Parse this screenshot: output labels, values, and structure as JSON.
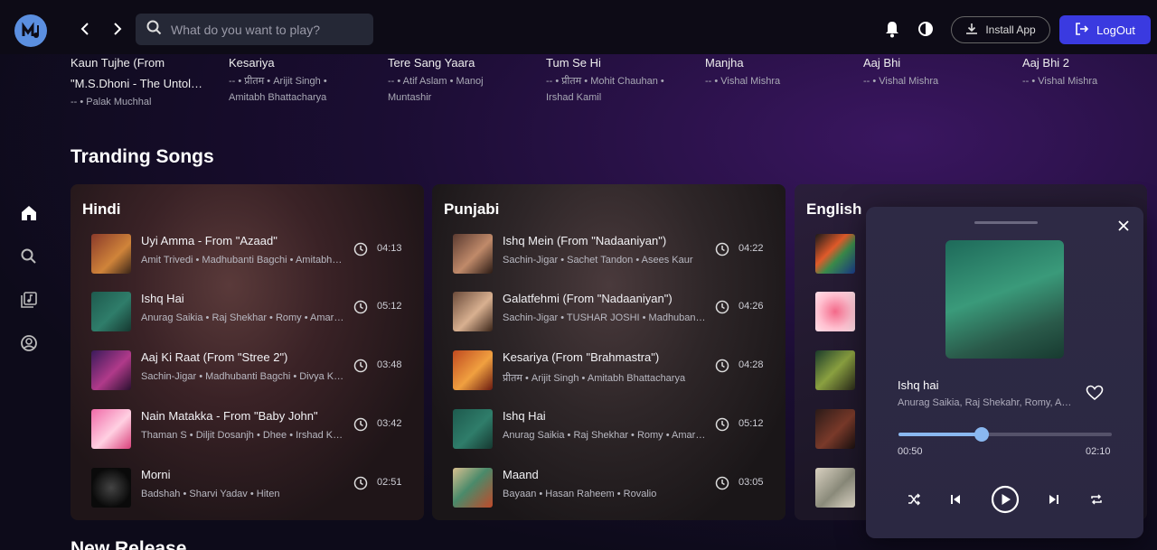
{
  "header": {
    "search_placeholder": "What do you want to play?",
    "install_label": "Install App",
    "logout_label": "LogOut"
  },
  "recent": [
    {
      "title1": "Kaun Tujhe (From",
      "title2": "\"M.S.Dhoni - The Untol…",
      "sub": "-- • Palak Muchhal"
    },
    {
      "title1": "Kesariya",
      "sub1": "-- • प्रीतम • Arijit Singh •",
      "sub2": "Amitabh Bhattacharya"
    },
    {
      "title1": "Tere Sang Yaara",
      "sub1": "-- • Atif Aslam • Manoj",
      "sub2": "Muntashir"
    },
    {
      "title1": "Tum Se Hi",
      "sub1": "-- • प्रीतम • Mohit Chauhan •",
      "sub2": "Irshad Kamil"
    },
    {
      "title1": "Manjha",
      "sub1": "-- • Vishal Mishra"
    },
    {
      "title1": "Aaj Bhi",
      "sub1": "-- • Vishal Mishra"
    },
    {
      "title1": "Aaj Bhi 2",
      "sub1": "-- • Vishal Mishra"
    }
  ],
  "trending_title": "Tranding Songs",
  "new_release_title": "New Release",
  "cards": [
    {
      "title": "Hindi",
      "songs": [
        {
          "name": "Uyi Amma - From \"Azaad\"",
          "artist": "Amit Trivedi • Madhubanti Bagchi • Amitabh Bhattacharya",
          "duration": "04:13"
        },
        {
          "name": "Ishq Hai",
          "artist": "Anurag Saikia • Raj Shekhar • Romy • Amarabha Banerjee",
          "duration": "05:12"
        },
        {
          "name": "Aaj Ki Raat (From \"Stree 2\")",
          "artist": "Sachin-Jigar • Madhubanti Bagchi • Divya Kumar",
          "duration": "03:48"
        },
        {
          "name": "Nain Matakka - From \"Baby John\"",
          "artist": "Thaman S • Diljit Dosanjh • Dhee • Irshad Kamil",
          "duration": "03:42"
        },
        {
          "name": "Morni",
          "artist": "Badshah • Sharvi Yadav • Hiten",
          "duration": "02:51"
        }
      ]
    },
    {
      "title": "Punjabi",
      "songs": [
        {
          "name": "Ishq Mein (From \"Nadaaniyan\")",
          "artist": "Sachin-Jigar • Sachet Tandon • Asees Kaur",
          "duration": "04:22"
        },
        {
          "name": "Galatfehmi (From \"Nadaaniyan\")",
          "artist": "Sachin-Jigar • TUSHAR JOSHI • Madhubanti Bagchi",
          "duration": "04:26"
        },
        {
          "name": "Kesariya (From \"Brahmastra\")",
          "artist": "प्रीतम • Arijit Singh • Amitabh Bhattacharya",
          "duration": "04:28"
        },
        {
          "name": "Ishq Hai",
          "artist": "Anurag Saikia • Raj Shekhar • Romy • Amarabha Banerjee",
          "duration": "05:12"
        },
        {
          "name": "Maand",
          "artist": "Bayaan • Hasan Raheem • Rovalio",
          "duration": "03:05"
        }
      ]
    },
    {
      "title": "English",
      "songs": [
        {
          "name": "",
          "artist": "",
          "duration": ""
        },
        {
          "name": "",
          "artist": "",
          "duration": ""
        },
        {
          "name": "",
          "artist": "",
          "duration": ""
        },
        {
          "name": "",
          "artist": "",
          "duration": ""
        },
        {
          "name": "",
          "artist": "",
          "duration": ""
        }
      ]
    }
  ],
  "player": {
    "title": "Ishq hai",
    "artist": "Anurag Saikia, Raj Shekahr, Romy, Amarabha Banerjee",
    "current_time": "00:50",
    "total_time": "02:10",
    "progress": 0.39
  },
  "colors": {
    "accent": "#3a3ae0",
    "progress": "#8ab8f0"
  }
}
